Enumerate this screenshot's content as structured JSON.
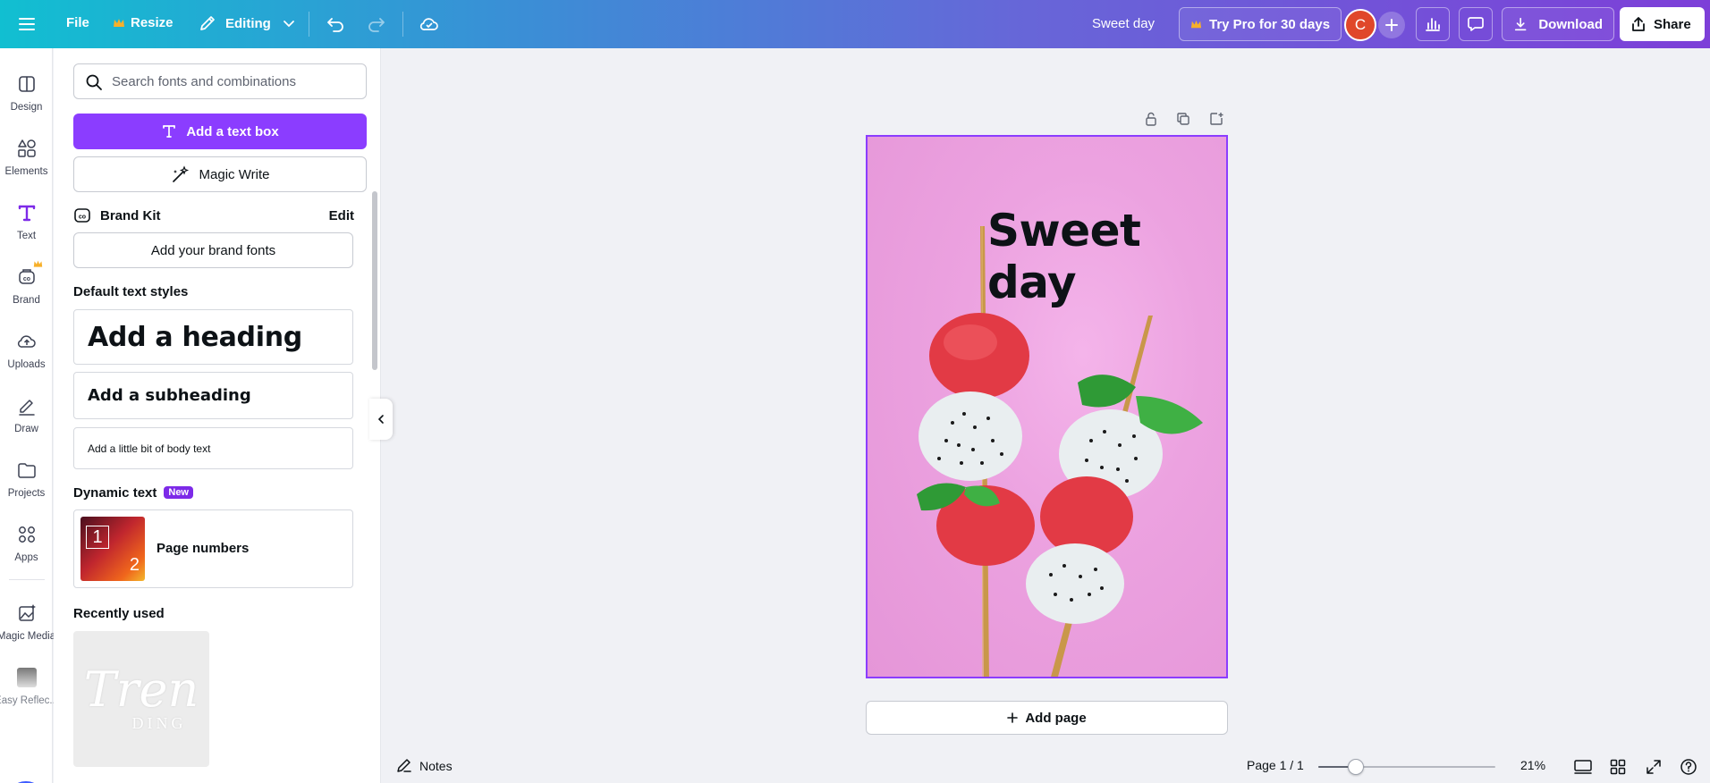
{
  "topbar": {
    "file_label": "File",
    "resize_label": "Resize",
    "editing_label": "Editing",
    "doc_title": "Sweet day",
    "try_pro_label": "Try Pro for 30 days",
    "avatar_initial": "C",
    "download_label": "Download",
    "share_label": "Share"
  },
  "rail": {
    "items": [
      {
        "label": "Design",
        "icon": "design-icon"
      },
      {
        "label": "Elements",
        "icon": "elements-icon"
      },
      {
        "label": "Text",
        "icon": "text-icon"
      },
      {
        "label": "Brand",
        "icon": "brand-icon"
      },
      {
        "label": "Uploads",
        "icon": "upload-cloud-icon"
      },
      {
        "label": "Draw",
        "icon": "pen-icon"
      },
      {
        "label": "Projects",
        "icon": "folder-icon"
      },
      {
        "label": "Apps",
        "icon": "apps-icon"
      },
      {
        "label": "Magic Media",
        "icon": "magic-media-icon"
      },
      {
        "label": "Easy Reflec...",
        "icon": "easy-reflections-icon"
      }
    ],
    "active": "Text"
  },
  "panel": {
    "search_placeholder": "Search fonts and combinations",
    "add_text_box_label": "Add a text box",
    "magic_write_label": "Magic Write",
    "brand_kit_label": "Brand Kit",
    "brand_kit_edit": "Edit",
    "add_brand_fonts_label": "Add your brand fonts",
    "default_styles_title": "Default text styles",
    "heading_label": "Add a heading",
    "subheading_label": "Add a subheading",
    "body_label": "Add a little bit of body text",
    "dynamic_text_title": "Dynamic text",
    "new_badge": "New",
    "page_numbers_label": "Page numbers",
    "page_numbers_thumb_top": "1",
    "page_numbers_thumb_bottom": "2",
    "recently_used_title": "Recently used",
    "recent_thumb_line1": "Tren",
    "recent_thumb_line2": "DING"
  },
  "canvas": {
    "page_text": "Sweet day",
    "add_page_label": "Add page",
    "page_color": "#eca2e0",
    "selection_color": "#8b3dff"
  },
  "bottombar": {
    "notes_label": "Notes",
    "page_indicator": "Page 1 / 1",
    "zoom_label": "21%",
    "zoom_fraction": 0.21
  },
  "colors": {
    "accent_purple": "#8b3dff",
    "avatar": "#e0472a",
    "crown": "#f7b02a"
  }
}
